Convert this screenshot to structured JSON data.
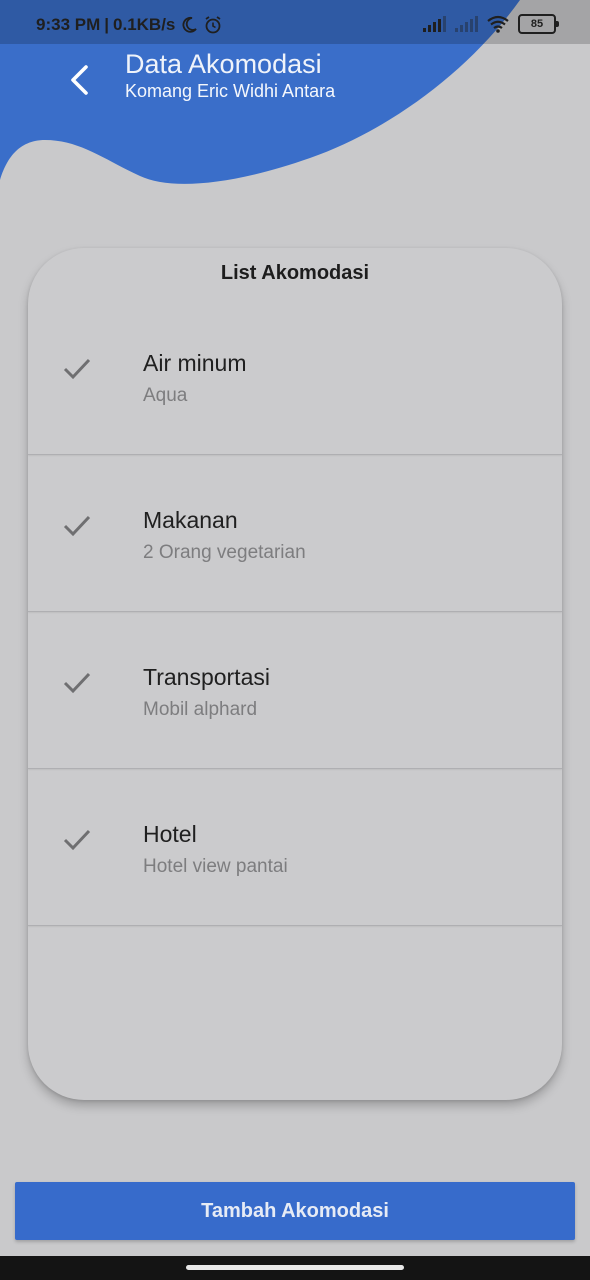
{
  "status_bar": {
    "time": "9:33 PM",
    "network_speed": "0.1KB/s",
    "battery_level": "85",
    "icons": [
      "moon-icon",
      "alarm-icon",
      "signal-icon",
      "signal-icon",
      "wifi-icon",
      "battery-icon"
    ]
  },
  "header": {
    "title": "Data Akomodasi",
    "subtitle": "Komang Eric Widhi Antara",
    "back_icon": "chevron-left-icon"
  },
  "card": {
    "title": "List Akomodasi",
    "items": [
      {
        "title": "Air minum",
        "subtitle": "Aqua",
        "icon": "check-icon"
      },
      {
        "title": "Makanan",
        "subtitle": "2 Orang vegetarian",
        "icon": "check-icon"
      },
      {
        "title": "Transportasi",
        "subtitle": "Mobil alphard",
        "icon": "check-icon"
      },
      {
        "title": "Hotel",
        "subtitle": "Hotel view pantai",
        "icon": "check-icon"
      }
    ]
  },
  "actions": {
    "add_label": "Tambah Akomodasi"
  },
  "colors": {
    "accent": "#376bcb",
    "background": "#c9c9cb",
    "header_wave": "#3a6ec9"
  }
}
